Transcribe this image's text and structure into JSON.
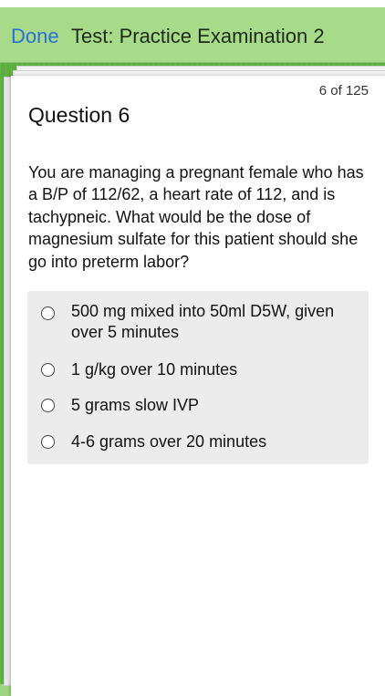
{
  "nav": {
    "done_label": "Done",
    "title": "Test: Practice Examination 2"
  },
  "question": {
    "counter": "6 of 125",
    "title": "Question 6",
    "text": "You are managing a pregnant female who has a B/P of 112/62, a heart rate of 112, and is tachypneic. What would be the dose of magnesium sulfate for this patient should she go into preterm labor?",
    "options": [
      "500 mg mixed into 50ml D5W, given over 5 minutes",
      "1 g/kg over 10 minutes",
      "5 grams slow IVP",
      "4-6 grams over 20 minutes"
    ]
  },
  "colors": {
    "nav_background": "#a7db8a",
    "link_blue": "#2a6fd6",
    "page_green": "#5cae3e",
    "options_panel": "#ececec"
  }
}
